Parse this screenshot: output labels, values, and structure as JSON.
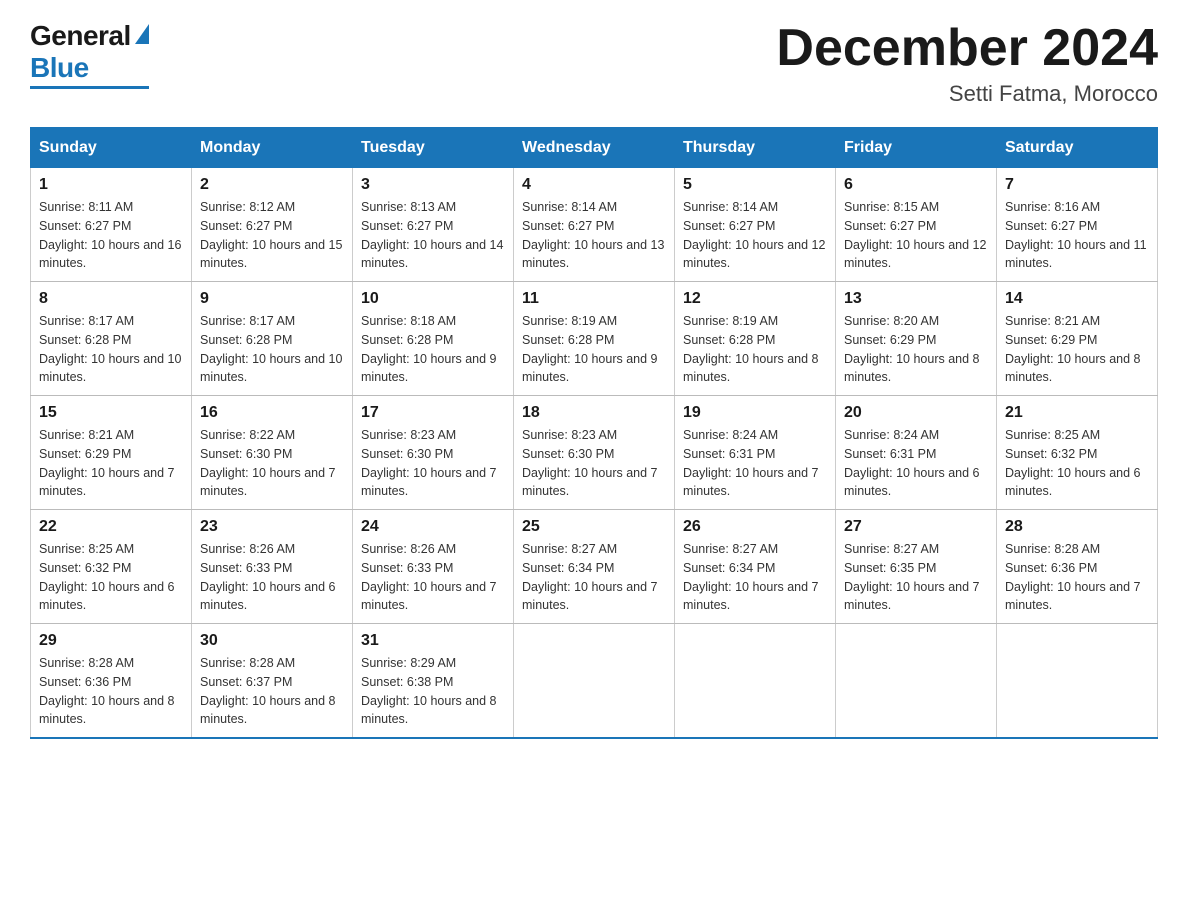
{
  "header": {
    "logo": {
      "general": "General",
      "blue": "Blue"
    },
    "title": "December 2024",
    "location": "Setti Fatma, Morocco"
  },
  "days_of_week": [
    "Sunday",
    "Monday",
    "Tuesday",
    "Wednesday",
    "Thursday",
    "Friday",
    "Saturday"
  ],
  "weeks": [
    [
      {
        "day": "1",
        "sunrise": "8:11 AM",
        "sunset": "6:27 PM",
        "daylight": "10 hours and 16 minutes."
      },
      {
        "day": "2",
        "sunrise": "8:12 AM",
        "sunset": "6:27 PM",
        "daylight": "10 hours and 15 minutes."
      },
      {
        "day": "3",
        "sunrise": "8:13 AM",
        "sunset": "6:27 PM",
        "daylight": "10 hours and 14 minutes."
      },
      {
        "day": "4",
        "sunrise": "8:14 AM",
        "sunset": "6:27 PM",
        "daylight": "10 hours and 13 minutes."
      },
      {
        "day": "5",
        "sunrise": "8:14 AM",
        "sunset": "6:27 PM",
        "daylight": "10 hours and 12 minutes."
      },
      {
        "day": "6",
        "sunrise": "8:15 AM",
        "sunset": "6:27 PM",
        "daylight": "10 hours and 12 minutes."
      },
      {
        "day": "7",
        "sunrise": "8:16 AM",
        "sunset": "6:27 PM",
        "daylight": "10 hours and 11 minutes."
      }
    ],
    [
      {
        "day": "8",
        "sunrise": "8:17 AM",
        "sunset": "6:28 PM",
        "daylight": "10 hours and 10 minutes."
      },
      {
        "day": "9",
        "sunrise": "8:17 AM",
        "sunset": "6:28 PM",
        "daylight": "10 hours and 10 minutes."
      },
      {
        "day": "10",
        "sunrise": "8:18 AM",
        "sunset": "6:28 PM",
        "daylight": "10 hours and 9 minutes."
      },
      {
        "day": "11",
        "sunrise": "8:19 AM",
        "sunset": "6:28 PM",
        "daylight": "10 hours and 9 minutes."
      },
      {
        "day": "12",
        "sunrise": "8:19 AM",
        "sunset": "6:28 PM",
        "daylight": "10 hours and 8 minutes."
      },
      {
        "day": "13",
        "sunrise": "8:20 AM",
        "sunset": "6:29 PM",
        "daylight": "10 hours and 8 minutes."
      },
      {
        "day": "14",
        "sunrise": "8:21 AM",
        "sunset": "6:29 PM",
        "daylight": "10 hours and 8 minutes."
      }
    ],
    [
      {
        "day": "15",
        "sunrise": "8:21 AM",
        "sunset": "6:29 PM",
        "daylight": "10 hours and 7 minutes."
      },
      {
        "day": "16",
        "sunrise": "8:22 AM",
        "sunset": "6:30 PM",
        "daylight": "10 hours and 7 minutes."
      },
      {
        "day": "17",
        "sunrise": "8:23 AM",
        "sunset": "6:30 PM",
        "daylight": "10 hours and 7 minutes."
      },
      {
        "day": "18",
        "sunrise": "8:23 AM",
        "sunset": "6:30 PM",
        "daylight": "10 hours and 7 minutes."
      },
      {
        "day": "19",
        "sunrise": "8:24 AM",
        "sunset": "6:31 PM",
        "daylight": "10 hours and 7 minutes."
      },
      {
        "day": "20",
        "sunrise": "8:24 AM",
        "sunset": "6:31 PM",
        "daylight": "10 hours and 6 minutes."
      },
      {
        "day": "21",
        "sunrise": "8:25 AM",
        "sunset": "6:32 PM",
        "daylight": "10 hours and 6 minutes."
      }
    ],
    [
      {
        "day": "22",
        "sunrise": "8:25 AM",
        "sunset": "6:32 PM",
        "daylight": "10 hours and 6 minutes."
      },
      {
        "day": "23",
        "sunrise": "8:26 AM",
        "sunset": "6:33 PM",
        "daylight": "10 hours and 6 minutes."
      },
      {
        "day": "24",
        "sunrise": "8:26 AM",
        "sunset": "6:33 PM",
        "daylight": "10 hours and 7 minutes."
      },
      {
        "day": "25",
        "sunrise": "8:27 AM",
        "sunset": "6:34 PM",
        "daylight": "10 hours and 7 minutes."
      },
      {
        "day": "26",
        "sunrise": "8:27 AM",
        "sunset": "6:34 PM",
        "daylight": "10 hours and 7 minutes."
      },
      {
        "day": "27",
        "sunrise": "8:27 AM",
        "sunset": "6:35 PM",
        "daylight": "10 hours and 7 minutes."
      },
      {
        "day": "28",
        "sunrise": "8:28 AM",
        "sunset": "6:36 PM",
        "daylight": "10 hours and 7 minutes."
      }
    ],
    [
      {
        "day": "29",
        "sunrise": "8:28 AM",
        "sunset": "6:36 PM",
        "daylight": "10 hours and 8 minutes."
      },
      {
        "day": "30",
        "sunrise": "8:28 AM",
        "sunset": "6:37 PM",
        "daylight": "10 hours and 8 minutes."
      },
      {
        "day": "31",
        "sunrise": "8:29 AM",
        "sunset": "6:38 PM",
        "daylight": "10 hours and 8 minutes."
      },
      null,
      null,
      null,
      null
    ]
  ],
  "labels": {
    "sunrise_prefix": "Sunrise: ",
    "sunset_prefix": "Sunset: ",
    "daylight_prefix": "Daylight: "
  }
}
